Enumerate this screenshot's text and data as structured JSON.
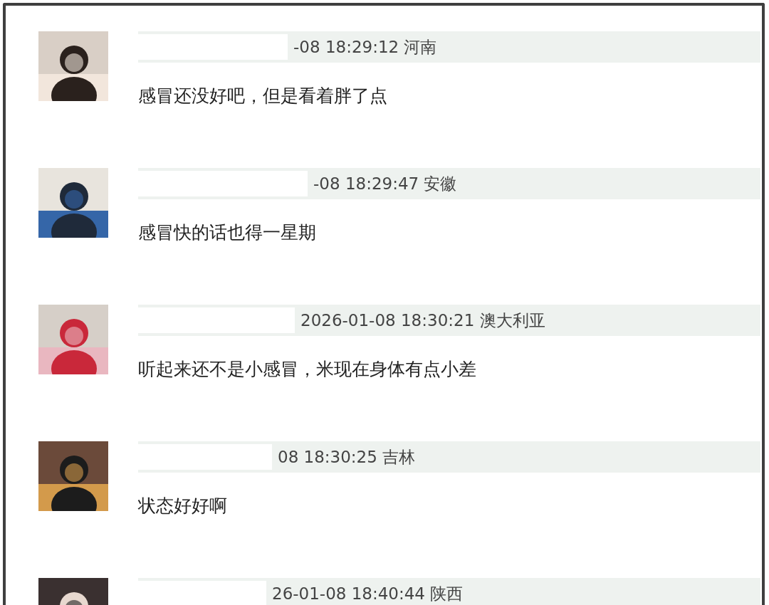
{
  "comments": [
    {
      "meta": "-08 18:29:12 河南",
      "text": "感冒还没好吧，但是看着胖了点"
    },
    {
      "meta": "-08 18:29:47 安徽",
      "text": "感冒快的话也得一星期"
    },
    {
      "meta": "2026-01-08 18:30:21 澳大利亚",
      "text": "听起来还不是小感冒，米现在身体有点小差"
    },
    {
      "meta": "08 18:30:25 吉林",
      "text": "状态好好啊"
    },
    {
      "meta": "26-01-08 18:40:44 陕西"
    }
  ]
}
